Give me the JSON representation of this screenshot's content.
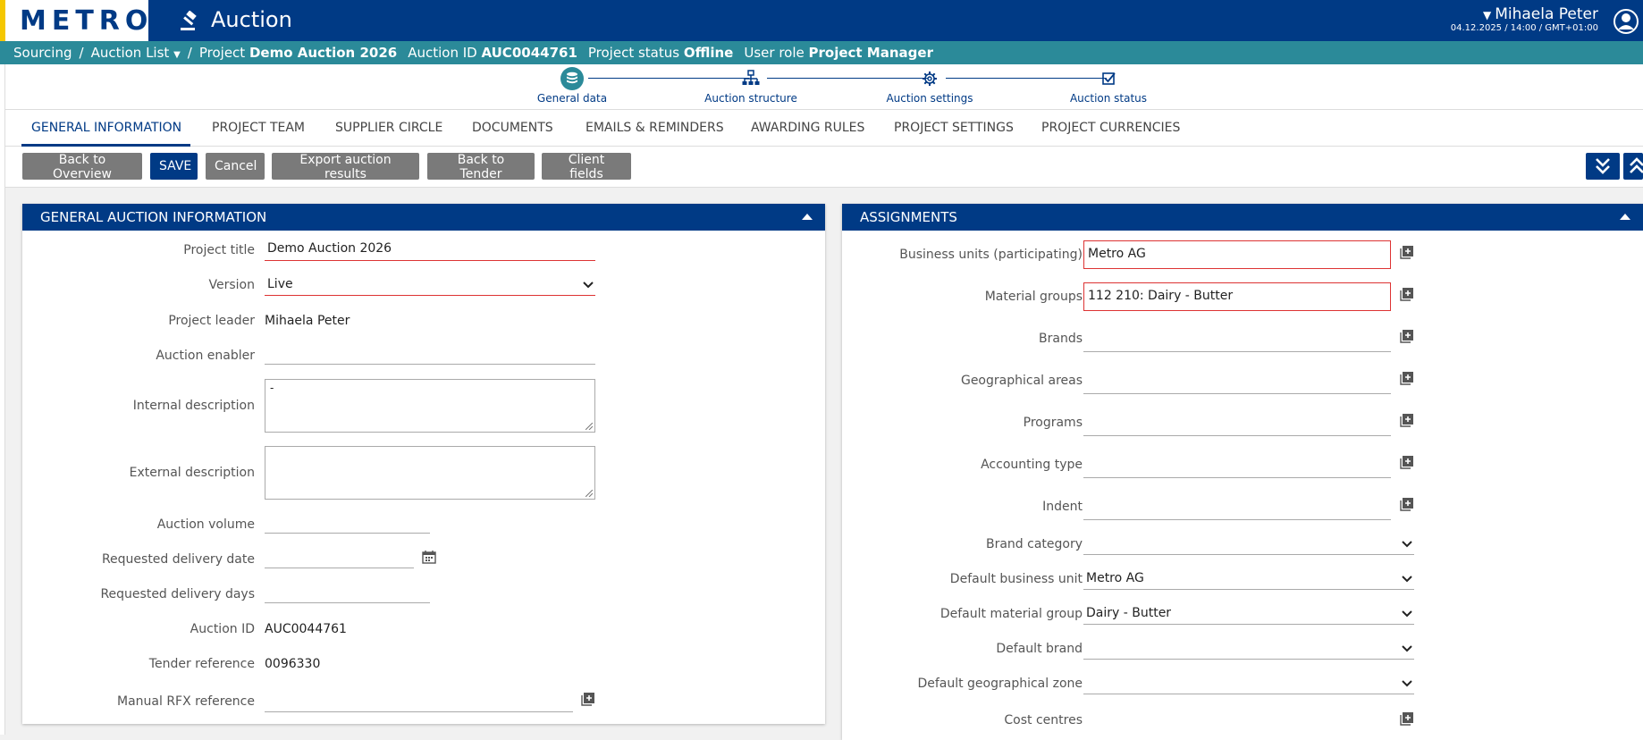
{
  "header": {
    "logo_text": "METRO",
    "app_title": "Auction",
    "user_name": "Mihaela Peter",
    "user_datetime": "04.12.2025 / 14:00 / GMT+01:00",
    "brand_color": "#003a85",
    "accent_color": "#2b8a99"
  },
  "breadcrumb": {
    "items": [
      "Sourcing",
      "Auction List"
    ],
    "project_label": "Project",
    "project_value": "Demo Auction 2026",
    "auction_id_label": "Auction ID",
    "auction_id_value": "AUC0044761",
    "status_label": "Project status",
    "status_value": "Offline",
    "role_label": "User role",
    "role_value": "Project Manager"
  },
  "stepper": {
    "steps": [
      {
        "label": "General data",
        "icon": "database-icon"
      },
      {
        "label": "Auction structure",
        "icon": "hierarchy-icon"
      },
      {
        "label": "Auction settings",
        "icon": "gear-icon"
      },
      {
        "label": "Auction status",
        "icon": "checkbox-icon"
      }
    ],
    "active_index": 0
  },
  "tabs": [
    {
      "label": "GENERAL INFORMATION",
      "active": true
    },
    {
      "label": "PROJECT TEAM"
    },
    {
      "label": "SUPPLIER CIRCLE"
    },
    {
      "label": "DOCUMENTS"
    },
    {
      "label": "EMAILS & REMINDERS"
    },
    {
      "label": "AWARDING RULES"
    },
    {
      "label": "PROJECT SETTINGS"
    },
    {
      "label": "PROJECT CURRENCIES"
    }
  ],
  "toolbar": {
    "back_overview": "Back to Overview",
    "save": "SAVE",
    "cancel": "Cancel",
    "export": "Export auction results",
    "back_tender": "Back to Tender",
    "client_fields": "Client fields"
  },
  "general_panel": {
    "title": "GENERAL AUCTION INFORMATION",
    "project_title_label": "Project title",
    "project_title_value": "Demo Auction 2026",
    "version_label": "Version",
    "version_value": "Live",
    "project_leader_label": "Project leader",
    "project_leader_value": "Mihaela Peter",
    "auction_enabler_label": "Auction enabler",
    "internal_desc_label": "Internal description",
    "internal_desc_value": "-",
    "external_desc_label": "External description",
    "auction_volume_label": "Auction volume",
    "req_delivery_date_label": "Requested delivery date",
    "req_delivery_days_label": "Requested delivery days",
    "auction_id_label": "Auction ID",
    "auction_id_value": "AUC0044761",
    "tender_ref_label": "Tender reference",
    "tender_ref_value": "0096330",
    "manual_rfx_label": "Manual RFX reference"
  },
  "assignments_panel": {
    "title": "ASSIGNMENTS",
    "business_units_label": "Business units (participating)",
    "business_units_value": "Metro AG",
    "material_groups_label": "Material groups",
    "material_groups_value": "112 210: Dairy - Butter",
    "brands_label": "Brands",
    "geo_areas_label": "Geographical areas",
    "programs_label": "Programs",
    "accounting_type_label": "Accounting type",
    "indent_label": "Indent",
    "brand_category_label": "Brand category",
    "default_bu_label": "Default business unit",
    "default_bu_value": "Metro AG",
    "default_mg_label": "Default material group",
    "default_mg_value": "Dairy - Butter",
    "default_brand_label": "Default brand",
    "default_geo_label": "Default geographical zone",
    "cost_centres_label": "Cost centres"
  }
}
